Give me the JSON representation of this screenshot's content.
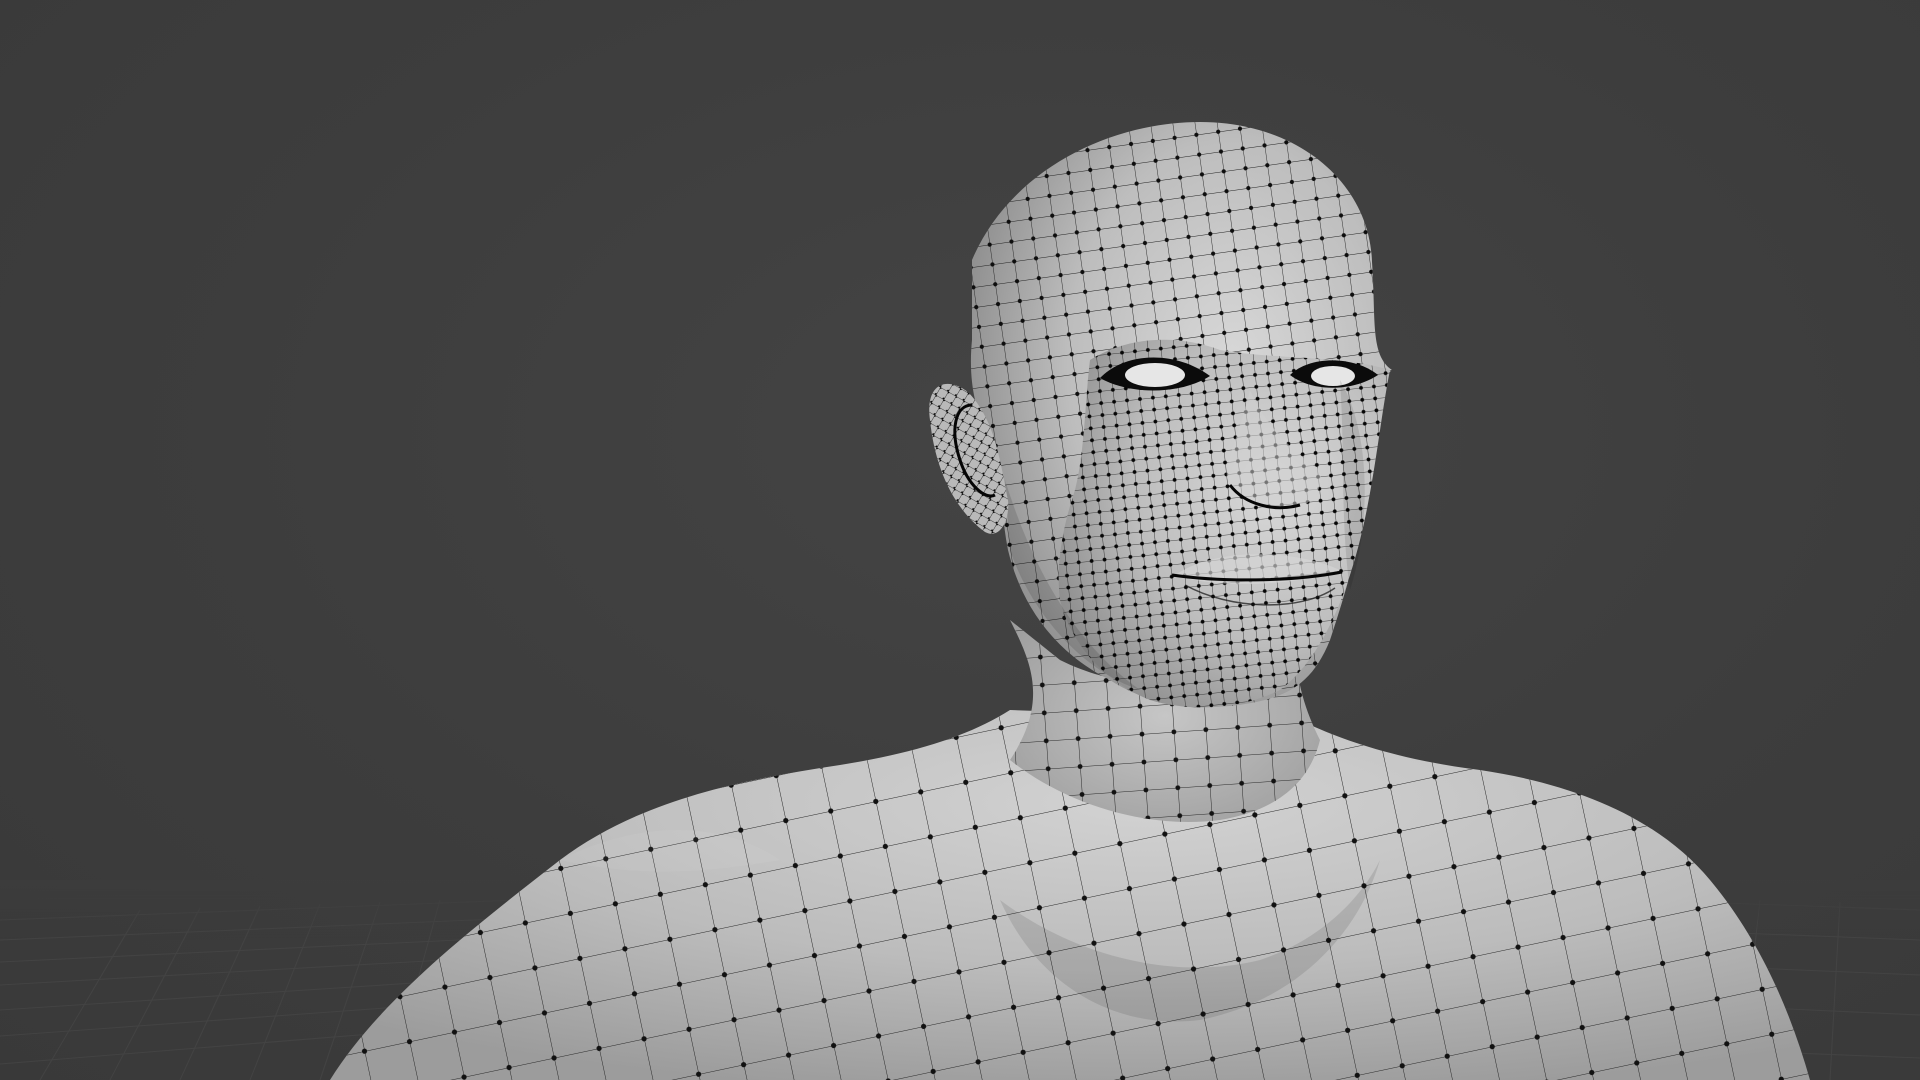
{
  "viewport": {
    "background_color": "#3d3d3d",
    "grid_line_color": "#4a4a4a",
    "mesh_surface_color": "#c9c9c9",
    "mesh_wire_color": "#1a1a1a",
    "mesh_vertex_color": "#000000",
    "overlays": {
      "wireframe": true,
      "vertices": true,
      "floor_grid": true
    },
    "subject": "human-bust-mesh"
  }
}
